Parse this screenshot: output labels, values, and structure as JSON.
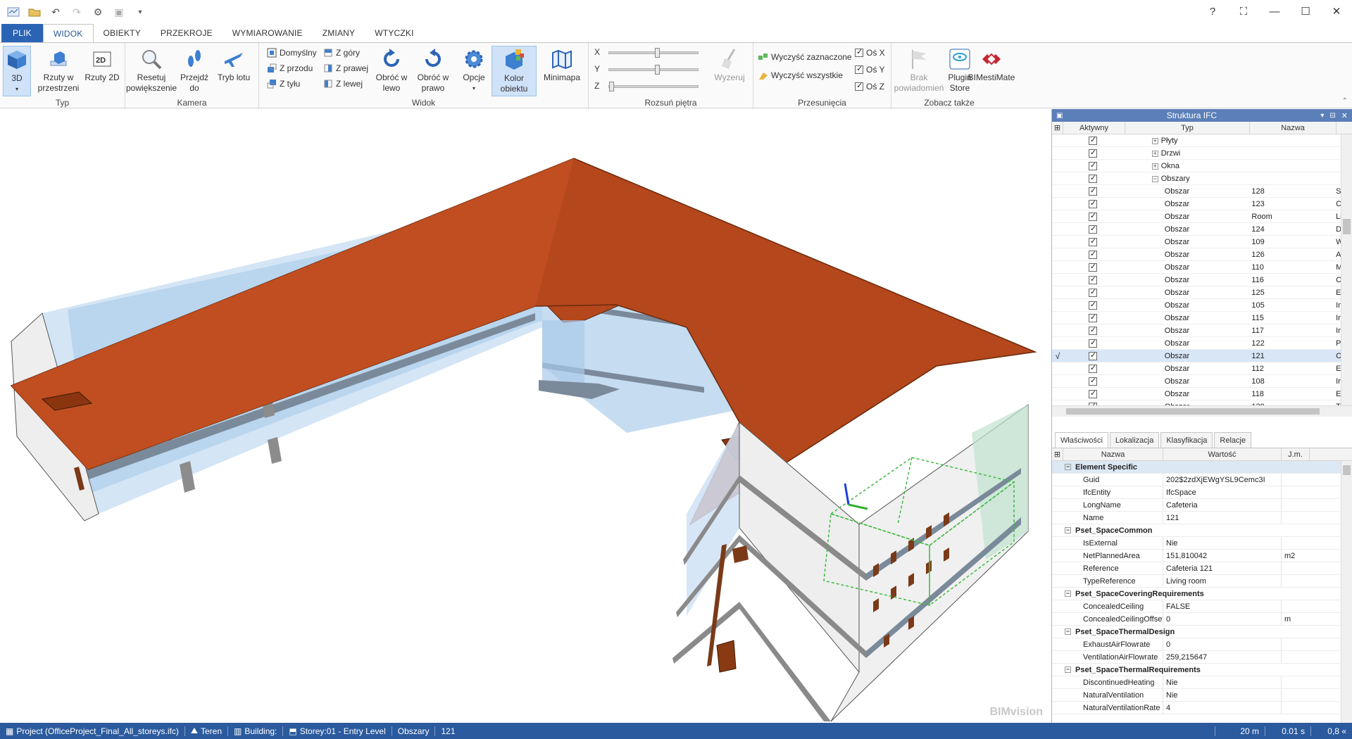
{
  "tabs": {
    "file": "PLIK",
    "items": [
      "WIDOK",
      "OBIEKTY",
      "PRZEKROJE",
      "WYMIAROWANIE",
      "ZMIANY",
      "WTYCZKI"
    ]
  },
  "titlebar": {
    "help": "?",
    "min": "—",
    "max": "☐",
    "close": "✕"
  },
  "ribbon": {
    "typ": {
      "label": "Typ",
      "b3d": "3D",
      "rzuty_przestrzeni": "Rzuty w przestrzeni",
      "rzuty2d": "Rzuty 2D"
    },
    "kamera": {
      "label": "Kamera",
      "reset": "Resetuj powiększenie",
      "przejdz": "Przejdź do",
      "tryb": "Tryb lotu"
    },
    "widok": {
      "label": "Widok",
      "domyslny": "Domyślny",
      "z_przodu": "Z przodu",
      "z_tylu": "Z tyłu",
      "z_gory": "Z góry",
      "z_prawej": "Z prawej",
      "z_lewej": "Z lewej",
      "obroc_lewo": "Obróć w lewo",
      "obroc_prawo": "Obróć w prawo",
      "opcje": "Opcje",
      "kolor": "Kolor obiektu",
      "minimapa": "Minimapa"
    },
    "rozsun": {
      "label": "Rozsuń piętra",
      "x": "X",
      "y": "Y",
      "z": "Z",
      "wyzeruj": "Wyzeruj",
      "x_pos": 0.54,
      "y_pos": 0.54,
      "z_pos": 0.0
    },
    "przesuniecia": {
      "label": "Przesunięcia",
      "wyczysc_zaz": "Wyczyść zaznaczone",
      "wyczysc_wsz": "Wyczyść wszystkie",
      "os_x": "Oś X",
      "os_y": "Oś Y",
      "os_z": "Oś Z"
    },
    "zobacz": {
      "label": "Zobacz także",
      "brak": "Brak powiadomień",
      "plugin": "Plugin Store",
      "bimestimate": "BIMestiMate"
    }
  },
  "ifc_panel": {
    "title": "Struktura IFC",
    "headers": {
      "aktywny": "Aktywny",
      "typ": "Typ",
      "nazwa": "Nazwa"
    },
    "rows": [
      {
        "typ": "Płyty",
        "group": true,
        "expand": "+",
        "nazwa": "",
        "extra": ""
      },
      {
        "typ": "Drzwi",
        "group": true,
        "expand": "+",
        "nazwa": "",
        "extra": ""
      },
      {
        "typ": "Okna",
        "group": true,
        "expand": "+",
        "nazwa": "",
        "extra": ""
      },
      {
        "typ": "Obszary",
        "group": true,
        "expand": "−",
        "nazwa": "",
        "extra": ""
      },
      {
        "typ": "Obszar",
        "nazwa": "128",
        "extra": "Str"
      },
      {
        "typ": "Obszar",
        "nazwa": "123",
        "extra": "Co"
      },
      {
        "typ": "Obszar",
        "nazwa": "Room",
        "extra": "Liv"
      },
      {
        "typ": "Obszar",
        "nazwa": "124",
        "extra": "Dr"
      },
      {
        "typ": "Obszar",
        "nazwa": "109",
        "extra": "Wo"
      },
      {
        "typ": "Obszar",
        "nazwa": "126",
        "extra": "Ad"
      },
      {
        "typ": "Obszar",
        "nazwa": "110",
        "extra": "Me"
      },
      {
        "typ": "Obszar",
        "nazwa": "116",
        "extra": "Co"
      },
      {
        "typ": "Obszar",
        "nazwa": "125",
        "extra": "Ele"
      },
      {
        "typ": "Obszar",
        "nazwa": "105",
        "extra": "Ins"
      },
      {
        "typ": "Obszar",
        "nazwa": "115",
        "extra": "Ins"
      },
      {
        "typ": "Obszar",
        "nazwa": "117",
        "extra": "Ins"
      },
      {
        "typ": "Obszar",
        "nazwa": "122",
        "extra": "Pre"
      },
      {
        "typ": "Obszar",
        "nazwa": "121",
        "extra": "Ca",
        "selected": true,
        "mark": "√"
      },
      {
        "typ": "Obszar",
        "nazwa": "112",
        "extra": "Ele"
      },
      {
        "typ": "Obszar",
        "nazwa": "108",
        "extra": "Ins"
      },
      {
        "typ": "Obszar",
        "nazwa": "118",
        "extra": "Ele"
      },
      {
        "typ": "Obszar",
        "nazwa": "129",
        "extra": "To"
      }
    ]
  },
  "prop_tabs": [
    "Właściwości",
    "Lokalizacja",
    "Klasyfikacja",
    "Relacje"
  ],
  "props": {
    "headers": {
      "nazwa": "Nazwa",
      "wartosc": "Wartość",
      "jm": "J.m."
    },
    "groups": [
      {
        "name": "Element Specific",
        "highlight": true,
        "rows": [
          {
            "n": "Guid",
            "v": "202$2zdXjEWgYSL9Cemc3I",
            "u": ""
          },
          {
            "n": "IfcEntity",
            "v": "IfcSpace",
            "u": ""
          },
          {
            "n": "LongName",
            "v": "Cafeteria",
            "u": ""
          },
          {
            "n": "Name",
            "v": "121",
            "u": ""
          }
        ]
      },
      {
        "name": "Pset_SpaceCommon",
        "rows": [
          {
            "n": "IsExternal",
            "v": "Nie",
            "u": ""
          },
          {
            "n": "NetPlannedArea",
            "v": "151,810042",
            "u": "m2"
          },
          {
            "n": "Reference",
            "v": "Cafeteria 121",
            "u": ""
          },
          {
            "n": "TypeReference",
            "v": "Living room",
            "u": ""
          }
        ]
      },
      {
        "name": "Pset_SpaceCoveringRequirements",
        "rows": [
          {
            "n": "ConcealedCeiling",
            "v": "FALSE",
            "u": ""
          },
          {
            "n": "ConcealedCeilingOffset",
            "v": "0",
            "u": "m"
          }
        ]
      },
      {
        "name": "Pset_SpaceThermalDesign",
        "rows": [
          {
            "n": "ExhaustAirFlowrate",
            "v": "0",
            "u": ""
          },
          {
            "n": "VentilationAirFlowrate",
            "v": "259,215647",
            "u": ""
          }
        ]
      },
      {
        "name": "Pset_SpaceThermalRequirements",
        "rows": [
          {
            "n": "DiscontinuedHeating",
            "v": "Nie",
            "u": ""
          },
          {
            "n": "NaturalVentilation",
            "v": "Nie",
            "u": ""
          },
          {
            "n": "NaturalVentilationRate",
            "v": "4",
            "u": ""
          }
        ]
      }
    ]
  },
  "view": {
    "watermark": "BIMvision"
  },
  "status": {
    "project": "Project (OfficeProject_Final_All_storeys.ifc)",
    "teren": "Teren",
    "building": "Building:",
    "storey": "Storey:01 - Entry Level",
    "obszary": "Obszary",
    "num": "121",
    "distance": "20 m",
    "time": "0.01 s",
    "fps": "0,8 «"
  },
  "colors": {
    "accent": "#2b64b5",
    "roof": "#b5471c",
    "status": "#2b5a9e",
    "panel_header": "#5b7fb8"
  }
}
